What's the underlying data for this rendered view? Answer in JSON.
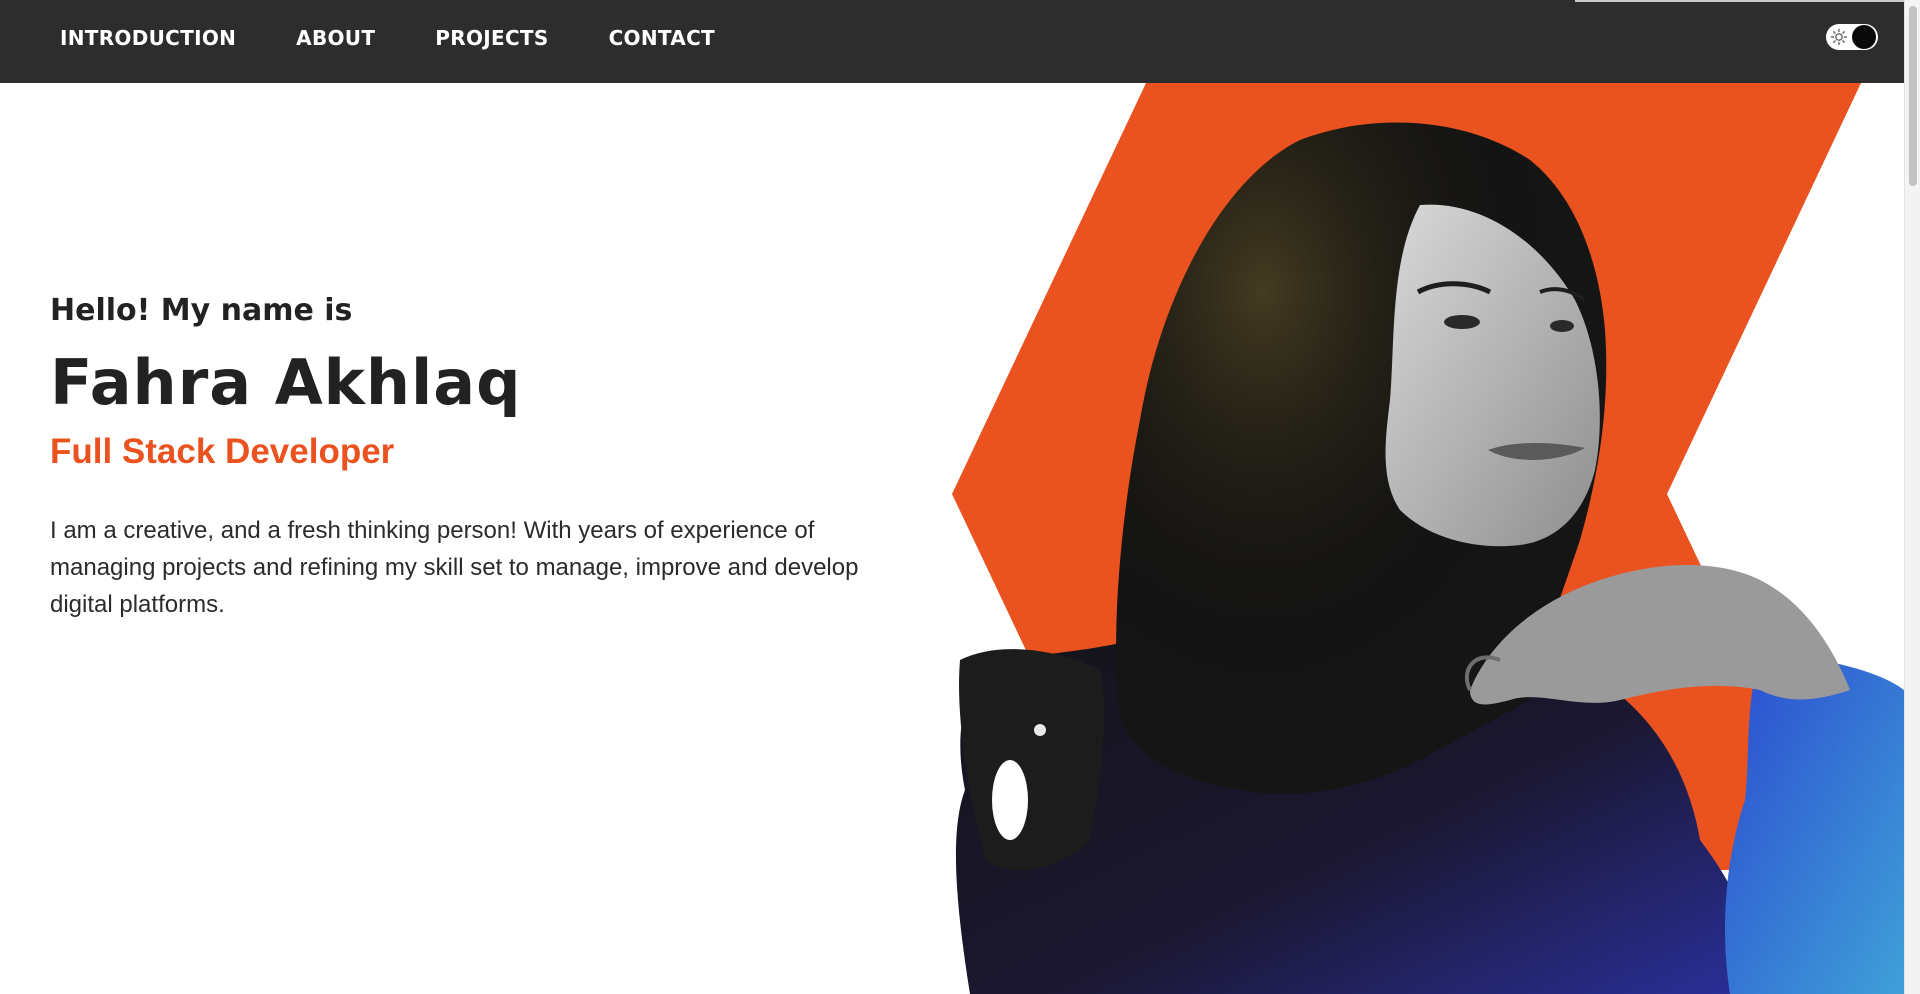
{
  "nav": {
    "links": [
      "INTRODUCTION",
      "ABOUT",
      "PROJECTS",
      "CONTACT"
    ]
  },
  "theme_toggle": {
    "icon": "sun-icon",
    "state": "dark"
  },
  "hero": {
    "greeting": "Hello! My name is",
    "name": "Fahra Akhlaq",
    "role": "Full Stack Developer",
    "bio": "I am a creative, and a fresh thinking person! With years of experience of managing projects and refining my skill set to manage, improve and develop digital platforms."
  },
  "colors": {
    "accent": "#ea531f",
    "navbar": "#2d2d2d",
    "text": "#222222"
  }
}
